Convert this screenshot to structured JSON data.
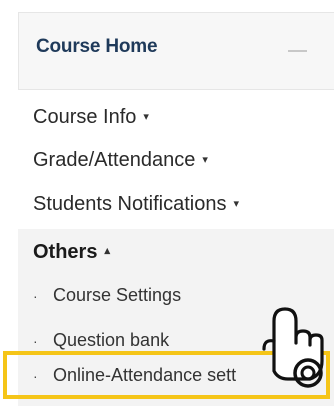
{
  "header": {
    "title": "Course Home",
    "collapse_icon": "minus-icon"
  },
  "menu": {
    "items": [
      {
        "label": "Course Info",
        "caret": "▾"
      },
      {
        "label": "Grade/Attendance",
        "caret": "▾"
      },
      {
        "label": "Students Notifications",
        "caret": "▾"
      }
    ]
  },
  "others": {
    "label": "Others",
    "caret": "▴",
    "items": [
      {
        "bullet": "·",
        "label": "Course Settings"
      },
      {
        "bullet": "·",
        "label": "Question bank"
      },
      {
        "bullet": "·",
        "label": "Online-Attendance sett"
      }
    ]
  },
  "highlight_color": "#f5c518",
  "pointer_icon": "pointing-hand-icon"
}
